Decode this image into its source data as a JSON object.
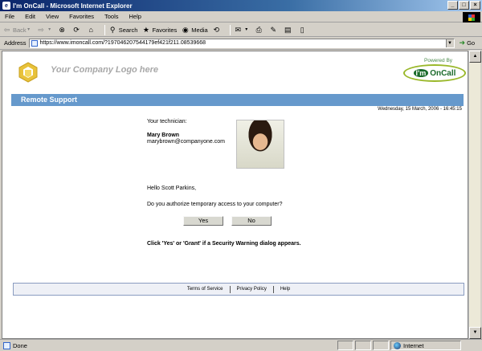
{
  "window": {
    "title": "I'm OnCall - Microsoft Internet Explorer"
  },
  "menu": [
    "File",
    "Edit",
    "View",
    "Favorites",
    "Tools",
    "Help"
  ],
  "toolbar": {
    "back": "Back",
    "forward": "",
    "search": "Search",
    "favorites": "Favorites",
    "media": "Media"
  },
  "address": {
    "label": "Address",
    "url": "https://www.imoncall.com/?197046207544179ef421f211.08539668",
    "go": "Go"
  },
  "page": {
    "company_logo": "Your Company Logo here",
    "powered_by": "Powered By",
    "brand_im": "I'm",
    "brand_oncall": "OnCall",
    "section_title": "Remote Support",
    "datetime": "Wednesday, 15 March, 2006 - 16:45:15",
    "technician_label": "Your technician:",
    "technician_name": "Mary Brown",
    "technician_email": "marybrown@companyone.com",
    "greeting": "Hello Scott Parkins,",
    "question": "Do you authorize temporary access to your computer?",
    "yes": "Yes",
    "no": "No",
    "warning": "Click 'Yes' or 'Grant' if a Security Warning dialog appears."
  },
  "footer": {
    "links": [
      "Terms of Service",
      "Privacy Policy",
      "Help"
    ]
  },
  "status": {
    "text": "Done",
    "zone": "Internet"
  }
}
